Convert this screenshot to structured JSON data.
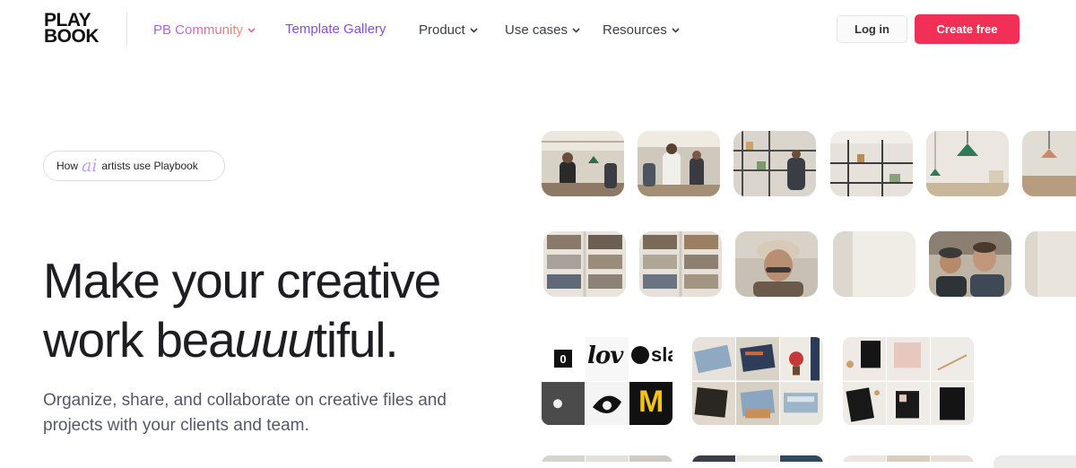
{
  "nav": {
    "logo_line1": "PLAY",
    "logo_line2": "BOOK",
    "items": [
      {
        "label": "PB Community",
        "has_dropdown": true
      },
      {
        "label": "Template Gallery",
        "has_dropdown": false
      },
      {
        "label": "Product",
        "has_dropdown": true
      },
      {
        "label": "Use cases",
        "has_dropdown": true
      },
      {
        "label": "Resources",
        "has_dropdown": true
      }
    ],
    "login_label": "Log in",
    "create_label": "Create free"
  },
  "hero": {
    "pill": {
      "prefix": "How",
      "ai_word": "ai",
      "suffix": "artists use Playbook"
    },
    "headline_line1": "Make your creative",
    "headline_line2_start": "work bea",
    "headline_line2_em": "uuu",
    "headline_line2_end": "tiful.",
    "subline": "Organize, share, and collaborate on creative files and projects with your clients and team."
  },
  "collage": {
    "logo_cell_text_lov": "lov",
    "logo_cell_text_sla": "sla",
    "logo_cell_text_zero": "0",
    "logo_cell_text_m": "M"
  },
  "colors": {
    "accent": "#f12f57",
    "community_gradient_start": "#a25cf0",
    "community_gradient_end": "#f7a66a",
    "template_gallery": "#8a4fd8",
    "ai_glyph": "#c3a0ee"
  },
  "icons": {
    "dropdown": "chevron-down-icon"
  }
}
